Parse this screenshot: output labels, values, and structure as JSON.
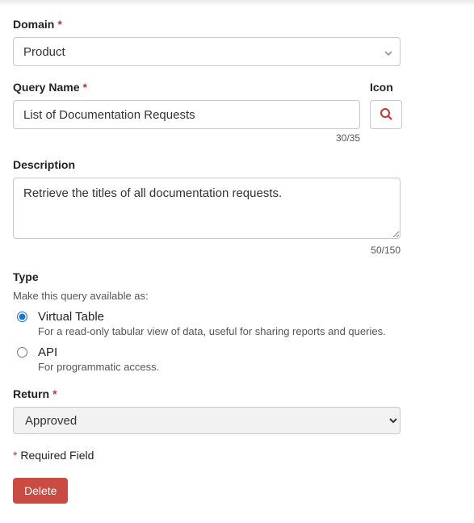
{
  "domain": {
    "label": "Domain",
    "required_mark": "*",
    "value": "Product"
  },
  "query_name": {
    "label": "Query Name",
    "required_mark": "*",
    "value": "List of Documentation Requests",
    "counter": "30/35"
  },
  "icon": {
    "label": "Icon"
  },
  "description": {
    "label": "Description",
    "value": "Retrieve the titles of all documentation requests.",
    "counter": "50/150"
  },
  "type": {
    "label": "Type",
    "subtext": "Make this query available as:",
    "options": {
      "virtual_table": {
        "label": "Virtual Table",
        "desc": "For a read-only tabular view of data, useful for sharing reports and queries."
      },
      "api": {
        "label": "API",
        "desc": "For programmatic access."
      }
    }
  },
  "return": {
    "label": "Return",
    "required_mark": "*",
    "value": "Approved"
  },
  "required_note": {
    "star": "*",
    "text": " Required Field"
  },
  "delete_button": "Delete"
}
